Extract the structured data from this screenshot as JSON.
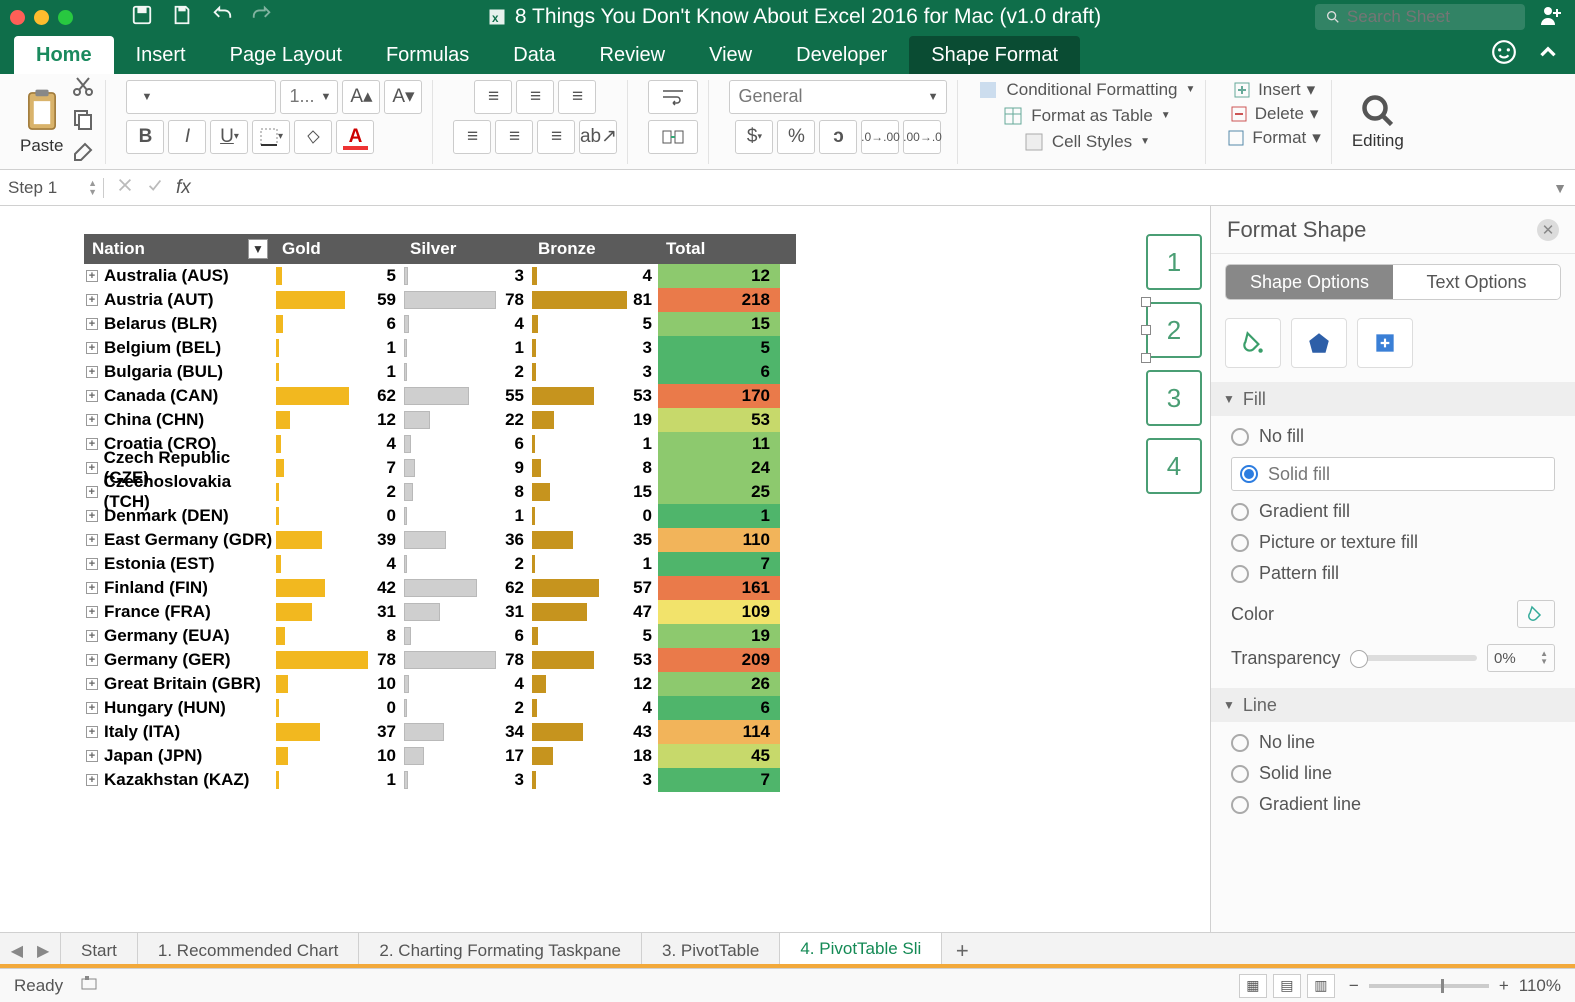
{
  "titlebar": {
    "title": "8 Things You Don't Know About Excel 2016 for Mac (v1.0 draft)",
    "search_placeholder": "Search Sheet"
  },
  "ribbon_tabs": [
    "Home",
    "Insert",
    "Page Layout",
    "Formulas",
    "Data",
    "Review",
    "View",
    "Developer",
    "Shape Format"
  ],
  "ribbon": {
    "paste": "Paste",
    "font_name": "",
    "font_size": "1...",
    "number_format": "General",
    "cond_format": "Conditional Formatting",
    "format_table": "Format as Table",
    "cell_styles": "Cell Styles",
    "insert": "Insert",
    "delete": "Delete",
    "format": "Format",
    "editing": "Editing"
  },
  "formula_bar": {
    "name_box": "Step 1"
  },
  "table": {
    "headers": {
      "nation": "Nation",
      "gold": "Gold",
      "silver": "Silver",
      "bronze": "Bronze",
      "total": "Total"
    },
    "max_medal": 85,
    "rows": [
      {
        "nation": "Australia (AUS)",
        "gold": 5,
        "silver": 3,
        "bronze": 4,
        "total": 12
      },
      {
        "nation": "Austria (AUT)",
        "gold": 59,
        "silver": 78,
        "bronze": 81,
        "total": 218
      },
      {
        "nation": "Belarus (BLR)",
        "gold": 6,
        "silver": 4,
        "bronze": 5,
        "total": 15
      },
      {
        "nation": "Belgium (BEL)",
        "gold": 1,
        "silver": 1,
        "bronze": 3,
        "total": 5
      },
      {
        "nation": "Bulgaria (BUL)",
        "gold": 1,
        "silver": 2,
        "bronze": 3,
        "total": 6
      },
      {
        "nation": "Canada (CAN)",
        "gold": 62,
        "silver": 55,
        "bronze": 53,
        "total": 170
      },
      {
        "nation": "China (CHN)",
        "gold": 12,
        "silver": 22,
        "bronze": 19,
        "total": 53
      },
      {
        "nation": "Croatia (CRO)",
        "gold": 4,
        "silver": 6,
        "bronze": 1,
        "total": 11
      },
      {
        "nation": "Czech Republic (CZE)",
        "gold": 7,
        "silver": 9,
        "bronze": 8,
        "total": 24
      },
      {
        "nation": "Czechoslovakia (TCH)",
        "gold": 2,
        "silver": 8,
        "bronze": 15,
        "total": 25
      },
      {
        "nation": "Denmark (DEN)",
        "gold": 0,
        "silver": 1,
        "bronze": 0,
        "total": 1
      },
      {
        "nation": "East Germany (GDR)",
        "gold": 39,
        "silver": 36,
        "bronze": 35,
        "total": 110
      },
      {
        "nation": "Estonia (EST)",
        "gold": 4,
        "silver": 2,
        "bronze": 1,
        "total": 7
      },
      {
        "nation": "Finland (FIN)",
        "gold": 42,
        "silver": 62,
        "bronze": 57,
        "total": 161
      },
      {
        "nation": "France (FRA)",
        "gold": 31,
        "silver": 31,
        "bronze": 47,
        "total": 109
      },
      {
        "nation": "Germany (EUA)",
        "gold": 8,
        "silver": 6,
        "bronze": 5,
        "total": 19
      },
      {
        "nation": "Germany (GER)",
        "gold": 78,
        "silver": 78,
        "bronze": 53,
        "total": 209
      },
      {
        "nation": "Great Britain (GBR)",
        "gold": 10,
        "silver": 4,
        "bronze": 12,
        "total": 26
      },
      {
        "nation": "Hungary (HUN)",
        "gold": 0,
        "silver": 2,
        "bronze": 4,
        "total": 6
      },
      {
        "nation": "Italy (ITA)",
        "gold": 37,
        "silver": 34,
        "bronze": 43,
        "total": 114
      },
      {
        "nation": "Japan (JPN)",
        "gold": 10,
        "silver": 17,
        "bronze": 18,
        "total": 45
      },
      {
        "nation": "Kazakhstan (KAZ)",
        "gold": 1,
        "silver": 3,
        "bronze": 3,
        "total": 7
      }
    ]
  },
  "slicers": [
    "1",
    "2",
    "3",
    "4"
  ],
  "pane": {
    "title": "Format Shape",
    "shape_options": "Shape Options",
    "text_options": "Text Options",
    "fill_hdr": "Fill",
    "line_hdr": "Line",
    "fill_opts": [
      "No fill",
      "Solid fill",
      "Gradient fill",
      "Picture or texture fill",
      "Pattern fill"
    ],
    "fill_selected": 1,
    "color_label": "Color",
    "transparency_label": "Transparency",
    "transparency_value": "0%",
    "line_opts": [
      "No line",
      "Solid line",
      "Gradient line"
    ]
  },
  "sheet_tabs": [
    "Start",
    "1. Recommended Chart",
    "2. Charting Formating Taskpane",
    "3. PivotTable",
    "4. PivotTable Sli"
  ],
  "sheet_active": 4,
  "status": {
    "ready": "Ready",
    "zoom": "110%"
  }
}
